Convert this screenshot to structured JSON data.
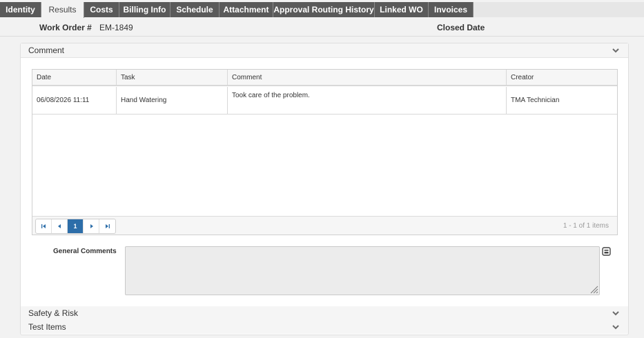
{
  "tabs": [
    {
      "label": "Identity"
    },
    {
      "label": "Results"
    },
    {
      "label": "Costs"
    },
    {
      "label": "Billing Info"
    },
    {
      "label": "Schedule"
    },
    {
      "label": "Attachment"
    },
    {
      "label": "Approval Routing History"
    },
    {
      "label": "Linked WO"
    },
    {
      "label": "Invoices"
    }
  ],
  "active_tab": "Results",
  "header": {
    "work_order_label": "Work Order #",
    "work_order_value": "EM-1849",
    "closed_date_label": "Closed Date",
    "closed_date_value": ""
  },
  "comment_section": {
    "title": "Comment",
    "grid": {
      "columns": [
        "Date",
        "Task",
        "Comment",
        "Creator"
      ],
      "rows": [
        {
          "date": "06/08/2026 11:11",
          "task": "Hand Watering",
          "comment": "Took care of the problem.",
          "creator": "TMA Technician"
        }
      ],
      "pager": {
        "current_page": "1",
        "info": "1 - 1 of 1 items"
      }
    },
    "general_comments_label": "General Comments",
    "general_comments_value": ""
  },
  "sections": [
    {
      "title": "Safety & Risk"
    },
    {
      "title": "Test Items"
    }
  ],
  "colors": {
    "tab_bg": "#5a5a5a",
    "page_bg": "#f2f2f2",
    "pager_active": "#2d6ea9"
  },
  "icons": [
    "chevron-down-icon",
    "first-page-icon",
    "prev-page-icon",
    "next-page-icon",
    "last-page-icon",
    "expand-editor-icon",
    "resize-handle-icon"
  ]
}
